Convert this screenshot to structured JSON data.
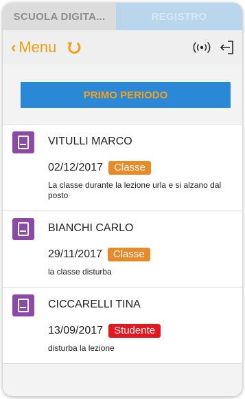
{
  "tabs": {
    "school": "SCUOLA DIGITA...",
    "registro": "REGISTRO"
  },
  "navbar": {
    "back_label": "Menu",
    "icons": [
      "chevron-left-icon",
      "refresh-icon",
      "broadcast-icon",
      "logout-icon"
    ]
  },
  "period_button": "PRIMO PERIODO",
  "colors": {
    "accent": "#f0a012",
    "period_bg": "#2a88d6",
    "item_icon": "#8b4aa8",
    "tag_classe": "#e8892a",
    "tag_studente": "#e8151c"
  },
  "notes": [
    {
      "name": "VITULLI MARCO",
      "date": "02/12/2017",
      "tag": "Classe",
      "tag_color": "#e8892a",
      "text": "La classe durante la lezione urla e si alzano dal posto"
    },
    {
      "name": "BIANCHI CARLO",
      "date": "29/11/2017",
      "tag": "Classe",
      "tag_color": "#e8892a",
      "text": "la classe disturba"
    },
    {
      "name": "CICCARELLI TINA",
      "date": "13/09/2017",
      "tag": "Studente",
      "tag_color": "#e8151c",
      "text": "disturba la lezione"
    }
  ]
}
